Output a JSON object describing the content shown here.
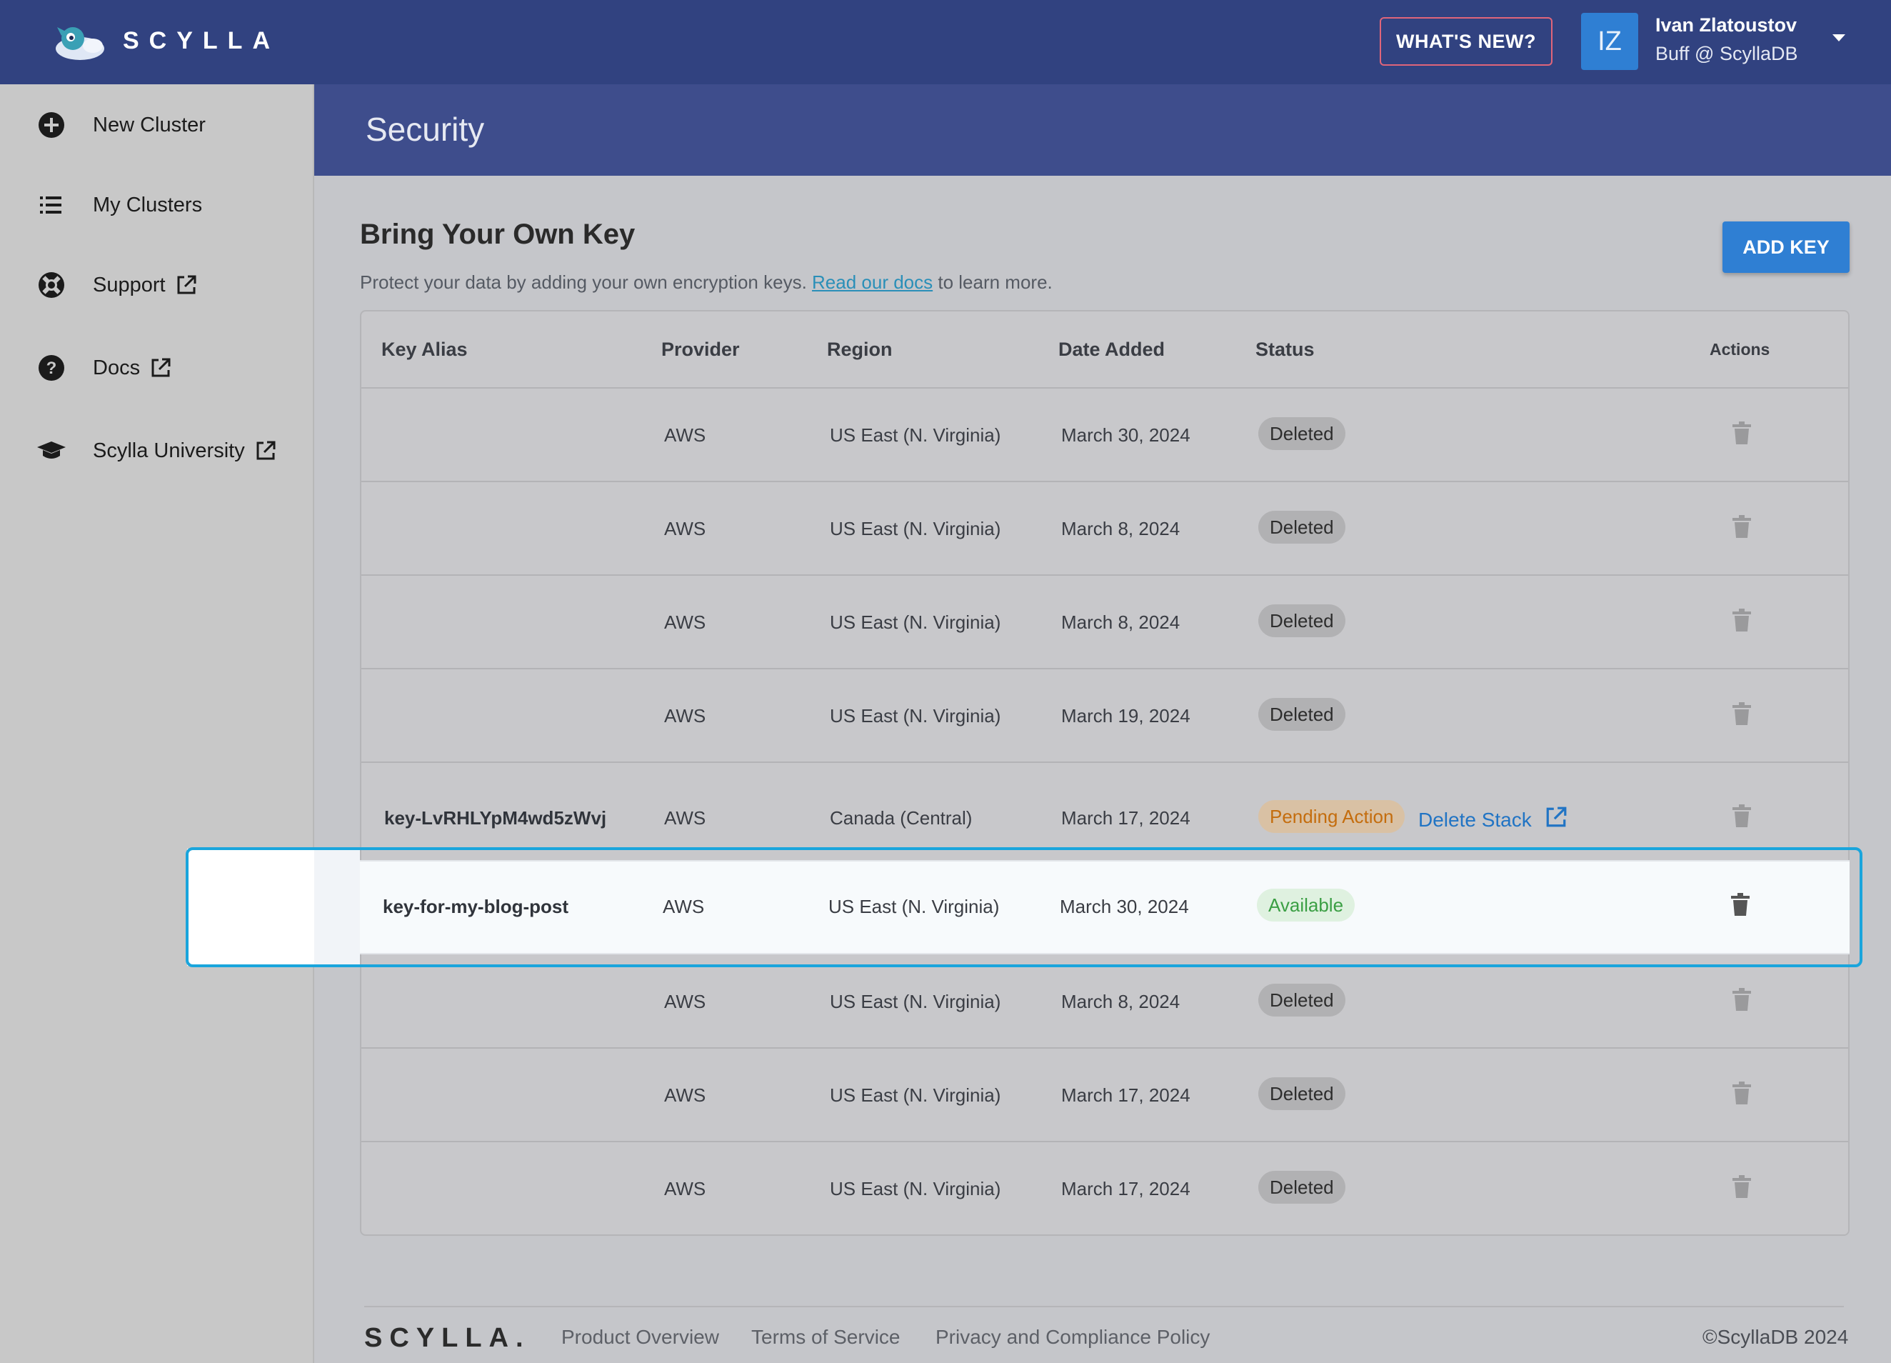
{
  "brand": {
    "name": "SCYLLA"
  },
  "topbar": {
    "whats_new": "WHAT'S NEW?",
    "avatar_initials": "IZ",
    "user_name": "Ivan Zlatoustov",
    "user_org": "Buff @ ScyllaDB"
  },
  "sidebar": {
    "items": [
      {
        "label": "New Cluster",
        "icon": "plus-circle-icon"
      },
      {
        "label": "My Clusters",
        "icon": "list-icon"
      },
      {
        "label": "Support",
        "icon": "lifebuoy-icon",
        "external": true
      },
      {
        "label": "Docs",
        "icon": "help-circle-icon",
        "external": true
      },
      {
        "label": "Scylla University",
        "icon": "graduation-cap-icon",
        "external": true
      }
    ]
  },
  "page": {
    "title": "Security"
  },
  "byok": {
    "title": "Bring Your Own Key",
    "desc_before": "Protect your data by adding your own encryption keys. ",
    "desc_link": "Read our docs",
    "desc_after": " to learn more.",
    "add_key": "ADD KEY"
  },
  "table": {
    "headers": {
      "alias": "Key Alias",
      "provider": "Provider",
      "region": "Region",
      "date": "Date Added",
      "status": "Status",
      "actions": "Actions"
    },
    "rows": [
      {
        "alias": "",
        "provider": "AWS",
        "region": "US East (N. Virginia)",
        "date": "March 30, 2024",
        "status": "Deleted"
      },
      {
        "alias": "",
        "provider": "AWS",
        "region": "US East (N. Virginia)",
        "date": "March 8, 2024",
        "status": "Deleted"
      },
      {
        "alias": "",
        "provider": "AWS",
        "region": "US East (N. Virginia)",
        "date": "March 8, 2024",
        "status": "Deleted"
      },
      {
        "alias": "",
        "provider": "AWS",
        "region": "US East (N. Virginia)",
        "date": "March 19, 2024",
        "status": "Deleted"
      },
      {
        "alias": "key-LvRHLYpM4wd5zWvj",
        "provider": "AWS",
        "region": "Canada (Central)",
        "date": "March 17, 2024",
        "status": "Pending Action",
        "action_link": "Delete Stack"
      },
      {
        "alias": "key-for-my-blog-post",
        "provider": "AWS",
        "region": "US East (N. Virginia)",
        "date": "March 30, 2024",
        "status": "Available"
      },
      {
        "alias": "",
        "provider": "AWS",
        "region": "US East (N. Virginia)",
        "date": "March 8, 2024",
        "status": "Deleted"
      },
      {
        "alias": "",
        "provider": "AWS",
        "region": "US East (N. Virginia)",
        "date": "March 17, 2024",
        "status": "Deleted"
      },
      {
        "alias": "",
        "provider": "AWS",
        "region": "US East (N. Virginia)",
        "date": "March 17, 2024",
        "status": "Deleted"
      }
    ]
  },
  "footer": {
    "logo": "SCYLLA.",
    "links": [
      "Product Overview",
      "Terms of Service",
      "Privacy and Compliance Policy"
    ],
    "copyright": "©ScyllaDB 2024"
  },
  "colors": {
    "topbar": "#314280",
    "accent": "#2f7fd3",
    "highlight": "#1aa5dc",
    "available": "#3b9f44",
    "pending": "#c46d0e"
  }
}
